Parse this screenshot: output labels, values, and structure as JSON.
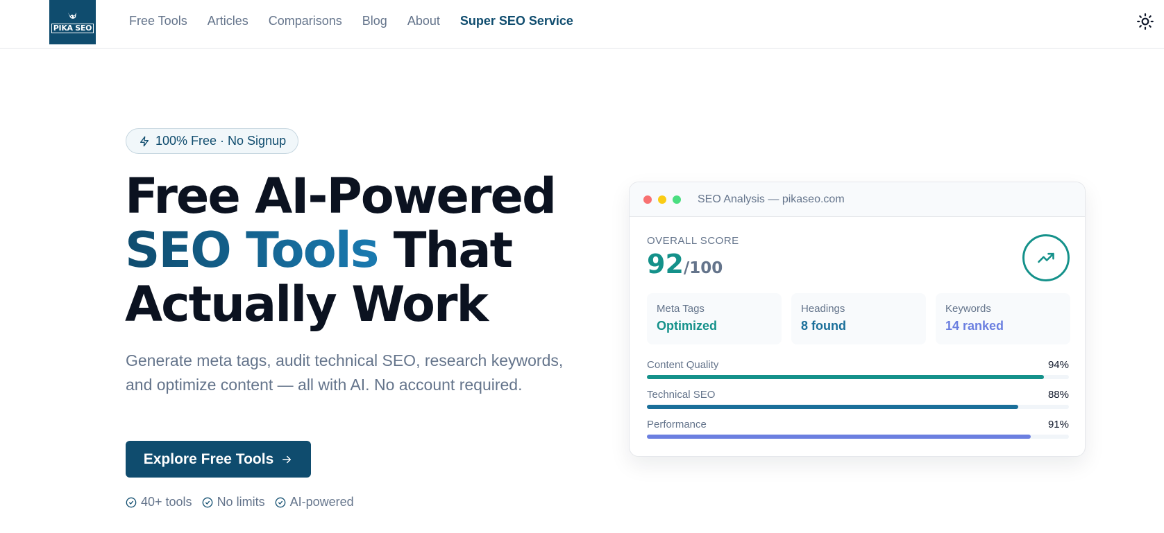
{
  "header": {
    "logo_text": "PIKA SEO",
    "nav": [
      {
        "label": "Free Tools"
      },
      {
        "label": "Articles"
      },
      {
        "label": "Comparisons"
      },
      {
        "label": "Blog"
      },
      {
        "label": "About"
      },
      {
        "label": "Super SEO Service"
      }
    ],
    "theme_icon": "sun-icon"
  },
  "hero": {
    "badge": "100% Free · No Signup",
    "headline_line1": "Free AI-Powered",
    "headline_grad": "SEO Tools",
    "headline_line2_rest": " That",
    "headline_line3": "Actually Work",
    "subtext": "Generate meta tags, audit technical SEO, research keywords, and optimize content — all with AI. No account required.",
    "cta_label": "Explore Free Tools",
    "features": [
      {
        "label": "40+ tools"
      },
      {
        "label": "No limits"
      },
      {
        "label": "AI-powered"
      }
    ]
  },
  "card": {
    "title": "SEO Analysis — pikaseo.com",
    "score_label": "OVERALL SCORE",
    "score_value": "92",
    "score_max": "/100",
    "stats": [
      {
        "label": "Meta Tags",
        "value": "Optimized",
        "color": "#14918a"
      },
      {
        "label": "Headings",
        "value": "8 found",
        "color": "#1a6f9a"
      },
      {
        "label": "Keywords",
        "value": "14 ranked",
        "color": "#6b7fe0"
      }
    ],
    "bars": [
      {
        "label": "Content Quality",
        "pct_text": "94%",
        "value": 94,
        "color": "#14918a"
      },
      {
        "label": "Technical SEO",
        "pct_text": "88%",
        "value": 88,
        "color": "#1a6f9a"
      },
      {
        "label": "Performance",
        "pct_text": "91%",
        "value": 91,
        "color": "#6b7fe0"
      }
    ]
  },
  "colors": {
    "brand": "#0f4c6e",
    "accent_teal": "#14918a",
    "window_red": "#f87171",
    "window_yellow": "#facc15",
    "window_green": "#4ade80"
  }
}
